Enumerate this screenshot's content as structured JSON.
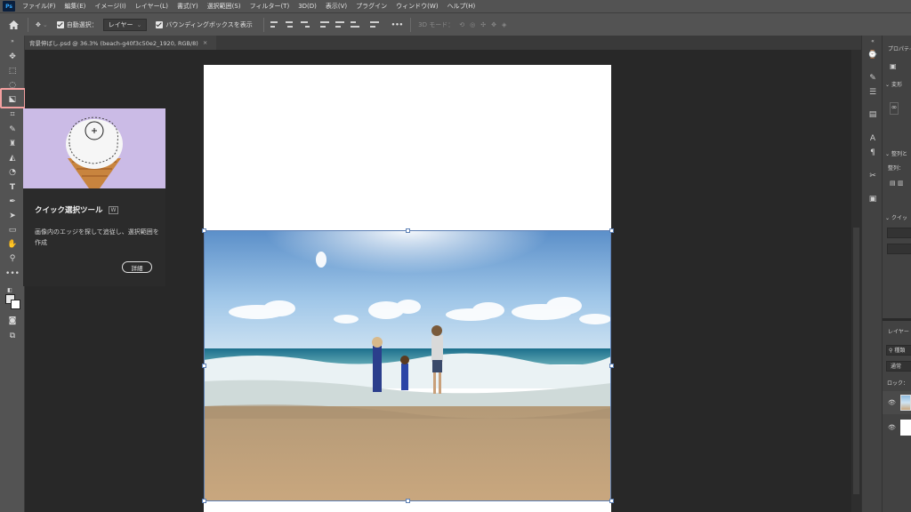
{
  "app": {
    "logo": "Ps"
  },
  "menu": [
    "ファイル(F)",
    "編集(E)",
    "イメージ(I)",
    "レイヤー(L)",
    "書式(Y)",
    "選択範囲(S)",
    "フィルター(T)",
    "3D(D)",
    "表示(V)",
    "プラグイン",
    "ウィンドウ(W)",
    "ヘルプ(H)"
  ],
  "options": {
    "auto_select_label": "自動選択：",
    "auto_select_value": "レイヤー",
    "bbox_label": "バウンディングボックスを表示",
    "more": "•••",
    "mode3d": "3D モード："
  },
  "document": {
    "tab_title": "背景伸ばし.psd @ 36.3% (beach-g40f3c50e2_1920, RGB/8)",
    "close": "×"
  },
  "tooltip": {
    "title": "クイック選択ツール",
    "shortcut": "W",
    "description": "画像内のエッジを探して追従し、選択範囲を作成",
    "button": "詳細"
  },
  "right_panel": {
    "properties_title": "プロパティ",
    "transform_label": "変形",
    "align_label": "整列と",
    "align_sub": "整列：",
    "quick_label": "クイッ",
    "layers_title": "レイヤー",
    "kind_label": "種類",
    "blend_mode": "通常",
    "lock_label": "ロック："
  },
  "colors": {
    "accent": "#31a8ff",
    "highlight": "#f4a0a0",
    "tooltip_bg": "#cbbbe6"
  }
}
